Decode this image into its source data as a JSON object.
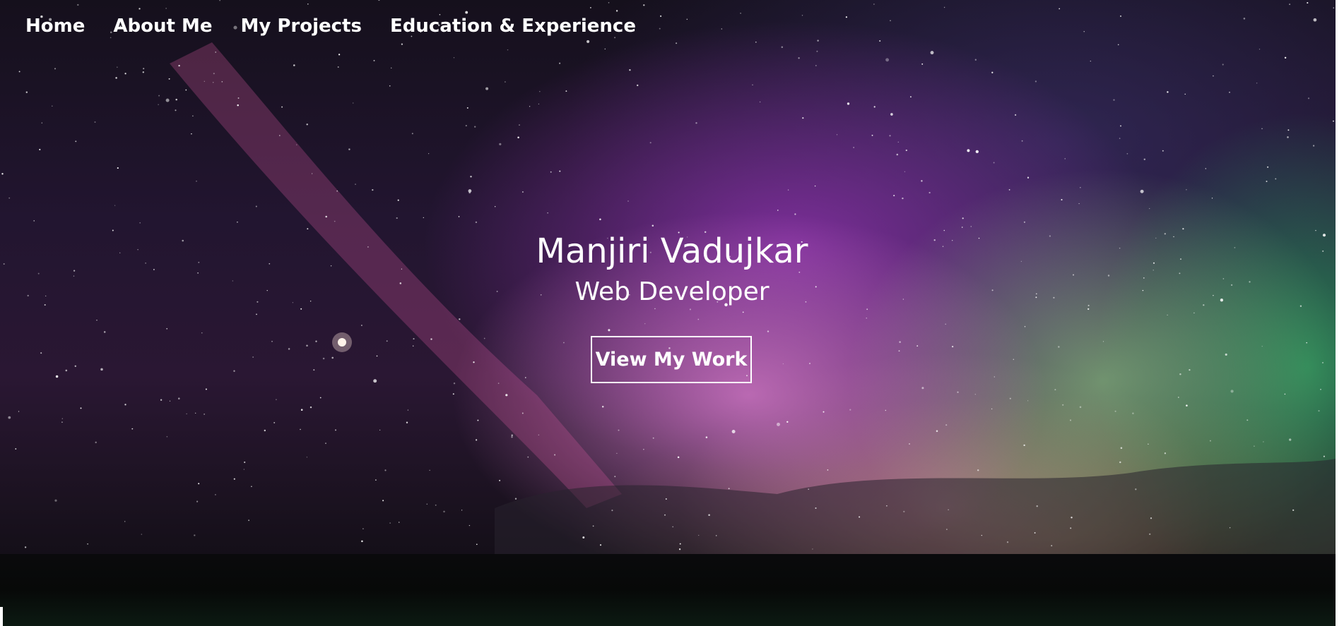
{
  "nav": {
    "items": [
      {
        "label": "Home"
      },
      {
        "label": "About Me"
      },
      {
        "label": "My Projects"
      },
      {
        "label": "Education & Experience"
      }
    ]
  },
  "hero": {
    "name": "Manjiri Vadujkar",
    "role": "Web Developer",
    "cta_label": "View My Work"
  },
  "colors": {
    "text": "#ffffff",
    "sky_purple": "#8c32aa",
    "aurora_pink": "#e182d2",
    "aurora_green": "#2c965a",
    "ground": "#0a0a0c"
  }
}
